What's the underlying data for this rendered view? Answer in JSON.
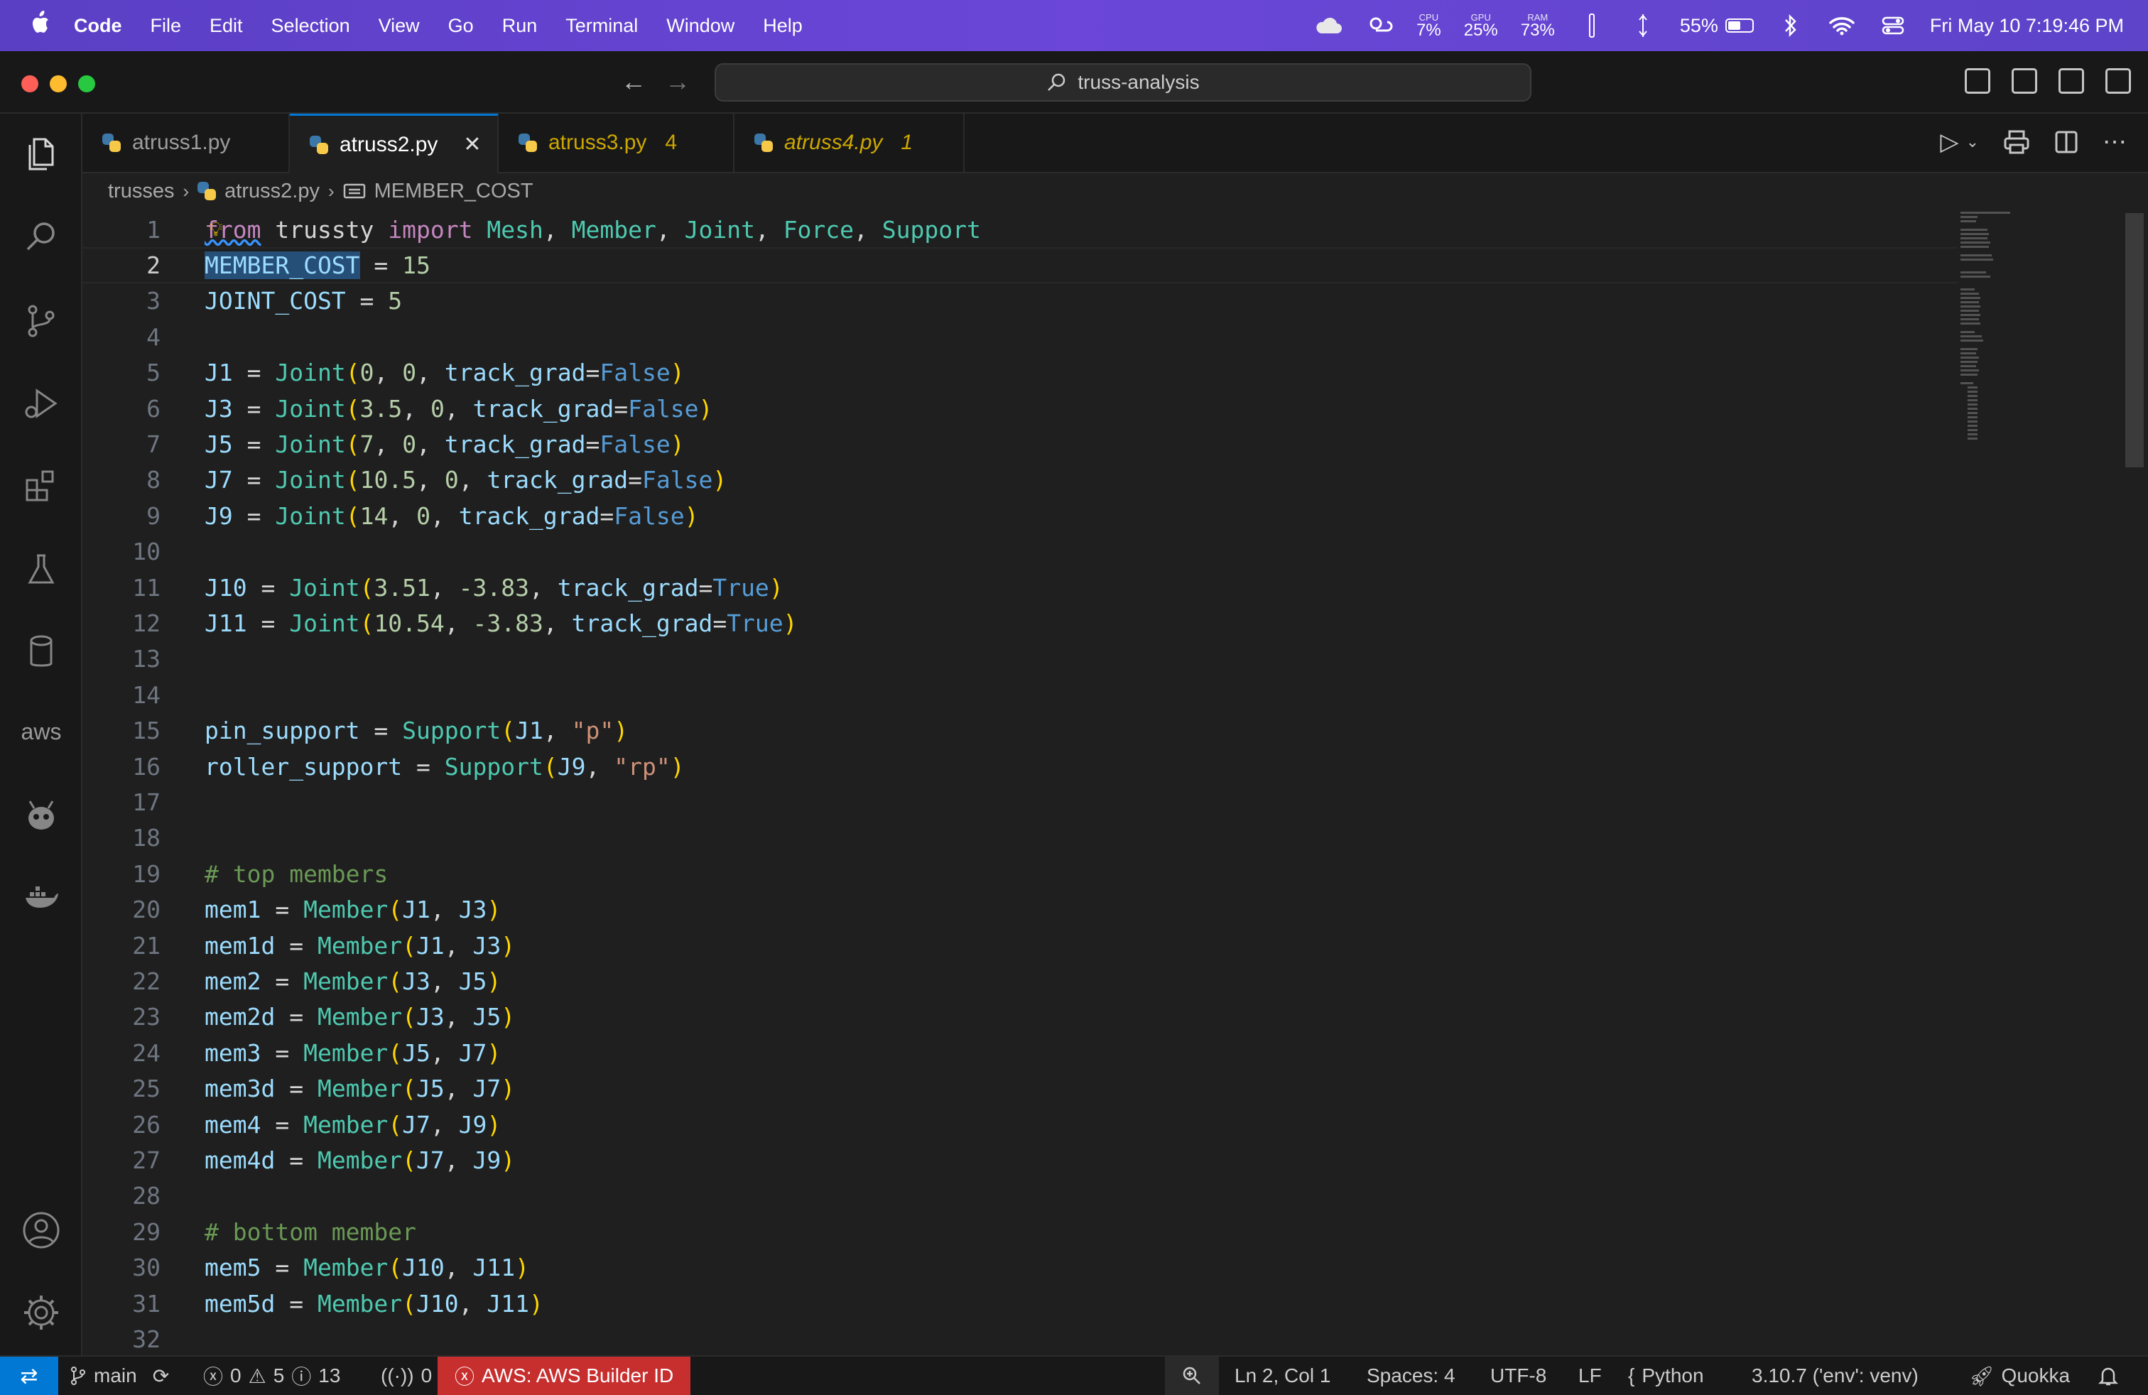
{
  "menubar": {
    "app": "Code",
    "items": [
      "File",
      "Edit",
      "Selection",
      "View",
      "Go",
      "Run",
      "Terminal",
      "Window",
      "Help"
    ],
    "cpu_label": "CPU",
    "cpu": "7%",
    "gpu_label": "GPU",
    "gpu": "25%",
    "ram_label": "RAM",
    "ram": "73%",
    "battery": "55%",
    "battery_level": 0.55,
    "datetime": "Fri May 10  7:19:46 PM"
  },
  "titlebar": {
    "search": "truss-analysis"
  },
  "tabs": [
    {
      "name": "atruss1.py",
      "badge": ""
    },
    {
      "name": "atruss2.py",
      "badge": ""
    },
    {
      "name": "atruss3.py",
      "badge": "4"
    },
    {
      "name": "atruss4.py",
      "badge": "1"
    }
  ],
  "breadcrumb": {
    "folder": "trusses",
    "file": "atruss2.py",
    "symbol": "MEMBER_COST"
  },
  "code": {
    "l1": {
      "a": "from",
      "b": " trussty ",
      "c": "import",
      "d": "Mesh",
      "e": "Member",
      "f": "Joint",
      "g": "Force",
      "h": "Support"
    },
    "l2": {
      "var": "MEMBER_COST",
      "op": " = ",
      "num": "15"
    },
    "l3": {
      "var": "JOINT_COST",
      "op": " = ",
      "num": "5"
    },
    "joints": [
      {
        "name": "J1",
        "x": "0",
        "y": "0",
        "tg": "False"
      },
      {
        "name": "J3",
        "x": "3.5",
        "y": "0",
        "tg": "False"
      },
      {
        "name": "J5",
        "x": "7",
        "y": "0",
        "tg": "False"
      },
      {
        "name": "J7",
        "x": "10.5",
        "y": "0",
        "tg": "False"
      },
      {
        "name": "J9",
        "x": "14",
        "y": "0",
        "tg": "False"
      },
      {
        "name": "J10",
        "x": "3.51",
        "y": "-3.83",
        "tg": "True"
      },
      {
        "name": "J11",
        "x": "10.54",
        "y": "-3.83",
        "tg": "True"
      }
    ],
    "supports": [
      {
        "name": "pin_support",
        "joint": "J1",
        "kind": "\"p\""
      },
      {
        "name": "roller_support",
        "joint": "J9",
        "kind": "\"rp\""
      }
    ],
    "comment_top": "# top members",
    "top_members": [
      {
        "name": "mem1",
        "a": "J1",
        "b": "J3"
      },
      {
        "name": "mem1d",
        "a": "J1",
        "b": "J3"
      },
      {
        "name": "mem2",
        "a": "J3",
        "b": "J5"
      },
      {
        "name": "mem2d",
        "a": "J3",
        "b": "J5"
      },
      {
        "name": "mem3",
        "a": "J5",
        "b": "J7"
      },
      {
        "name": "mem3d",
        "a": "J5",
        "b": "J7"
      },
      {
        "name": "mem4",
        "a": "J7",
        "b": "J9"
      },
      {
        "name": "mem4d",
        "a": "J7",
        "b": "J9"
      }
    ],
    "comment_bottom": "# bottom member",
    "bottom_members": [
      {
        "name": "mem5",
        "a": "J10",
        "b": "J11"
      },
      {
        "name": "mem5d",
        "a": "J10",
        "b": "J11"
      }
    ],
    "kw_joint": "Joint",
    "kw_support": "Support",
    "kw_member": "Member",
    "kw_trackgrad": "track_grad",
    "line_numbers": [
      "1",
      "2",
      "3",
      "4",
      "5",
      "6",
      "7",
      "8",
      "9",
      "10",
      "11",
      "12",
      "13",
      "14",
      "15",
      "16",
      "17",
      "18",
      "19",
      "20",
      "21",
      "22",
      "23",
      "24",
      "25",
      "26",
      "27",
      "28",
      "29",
      "30",
      "31",
      "32"
    ]
  },
  "statusbar": {
    "branch": "main",
    "errors": "0",
    "warnings": "5",
    "infos": "13",
    "ports": "0",
    "aws": "AWS: AWS Builder ID",
    "position": "Ln 2, Col 1",
    "spaces": "Spaces: 4",
    "encoding": "UTF-8",
    "eol": "LF",
    "language": "Python",
    "interpreter": "3.10.7 ('env': venv)",
    "quokka": "Quokka"
  },
  "colors": {
    "menubar": "#6b46d8",
    "accent": "#0078d4",
    "aws_badge": "#c72e2e",
    "keyword": "#c586c0",
    "class": "#4ec9b0",
    "variable": "#9cdcfe",
    "number": "#b5cea8",
    "string": "#ce9178",
    "boolean": "#569cd6",
    "comment": "#6a9955"
  }
}
